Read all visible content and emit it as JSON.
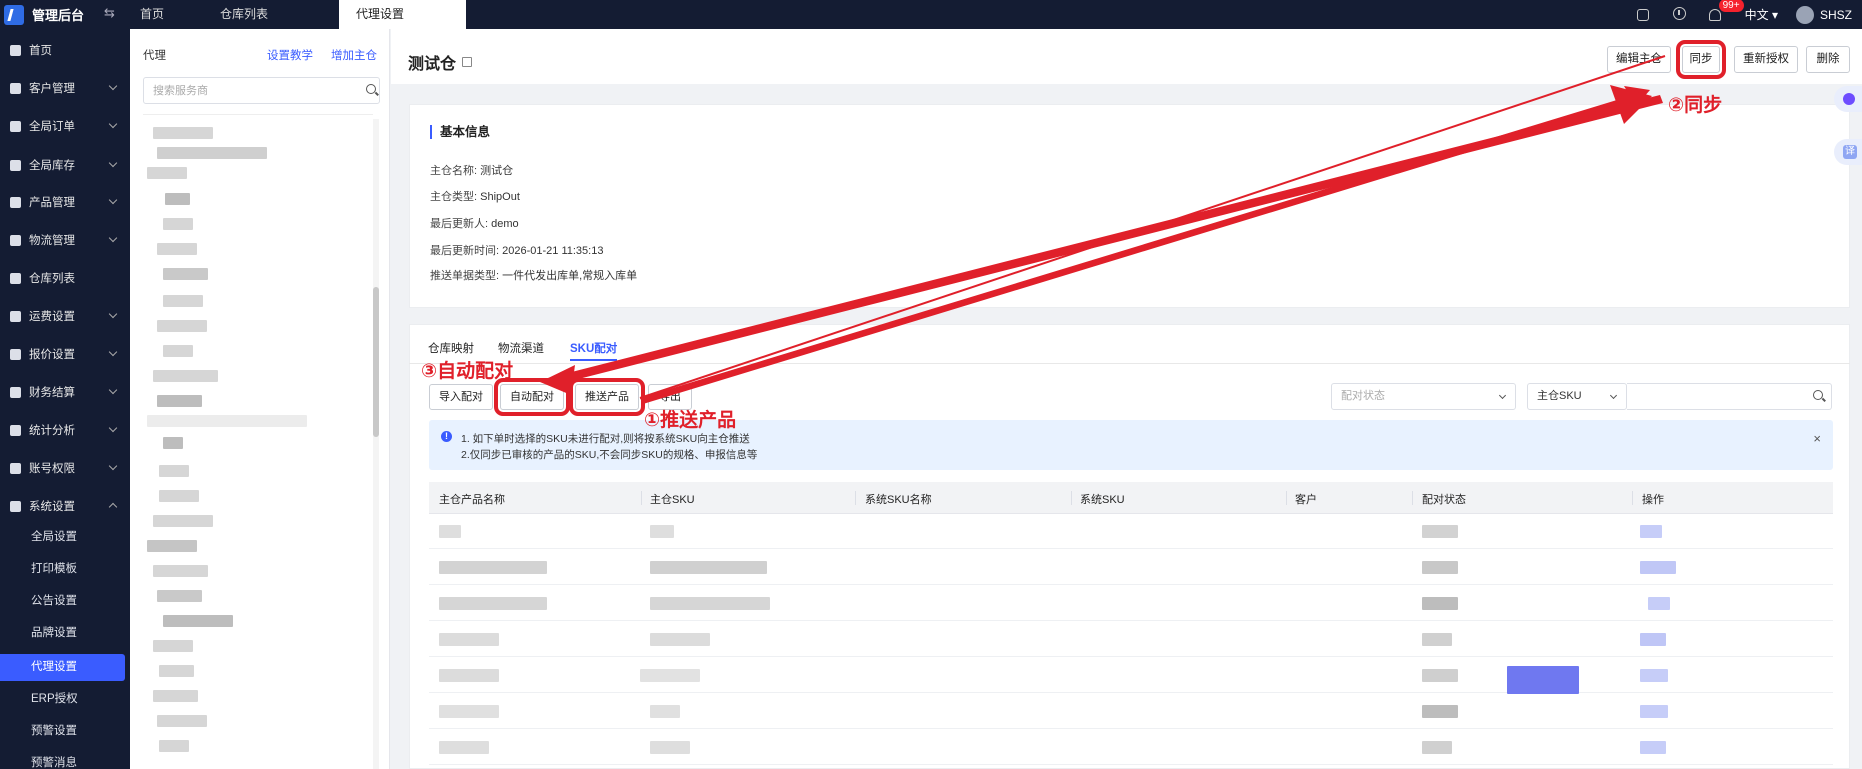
{
  "app": {
    "title": "管理后台",
    "tabs": [
      {
        "label": "首页",
        "active": false
      },
      {
        "label": "仓库列表",
        "active": false
      },
      {
        "label": "代理设置",
        "active": true
      }
    ],
    "notification_badge": "99+",
    "language": "中文",
    "user": "SHSZ"
  },
  "sidebar": {
    "items": [
      {
        "label": "首页",
        "icon": "home-icon",
        "expandable": false
      },
      {
        "label": "客户管理",
        "icon": "user-icon",
        "expandable": true
      },
      {
        "label": "全局订单",
        "icon": "order-icon",
        "expandable": true
      },
      {
        "label": "全局库存",
        "icon": "stock-icon",
        "expandable": true
      },
      {
        "label": "产品管理",
        "icon": "product-icon",
        "expandable": true
      },
      {
        "label": "物流管理",
        "icon": "truck-icon",
        "expandable": true
      },
      {
        "label": "仓库列表",
        "icon": "warehouse-icon",
        "expandable": false
      },
      {
        "label": "运费设置",
        "icon": "freight-icon",
        "expandable": true
      },
      {
        "label": "报价设置",
        "icon": "quote-icon",
        "expandable": true
      },
      {
        "label": "财务结算",
        "icon": "finance-icon",
        "expandable": true
      },
      {
        "label": "统计分析",
        "icon": "chart-icon",
        "expandable": true
      },
      {
        "label": "账号权限",
        "icon": "account-icon",
        "expandable": true
      },
      {
        "label": "系统设置",
        "icon": "settings-icon",
        "expandable": true,
        "expanded": true
      }
    ],
    "sub_items": [
      {
        "label": "全局设置",
        "active": false
      },
      {
        "label": "打印模板",
        "active": false
      },
      {
        "label": "公告设置",
        "active": false
      },
      {
        "label": "品牌设置",
        "active": false
      },
      {
        "label": "代理设置",
        "active": true
      },
      {
        "label": "ERP授权",
        "active": false
      },
      {
        "label": "预警设置",
        "active": false
      },
      {
        "label": "预警消息",
        "active": false
      }
    ]
  },
  "agent_panel": {
    "title": "代理",
    "tutorial_link": "设置教学",
    "add_link": "增加主仓",
    "search_placeholder": "搜索服务商"
  },
  "page": {
    "title": "测试仓",
    "buttons": {
      "edit": "编辑主仓",
      "sync": "同步",
      "reauth": "重新授权",
      "delete": "删除"
    }
  },
  "basic_info": {
    "title": "基本信息",
    "rows": [
      {
        "label": "主仓名称:",
        "value": "测试仓"
      },
      {
        "label": "主仓类型:",
        "value": "ShipOut"
      },
      {
        "label": "最后更新人:",
        "value": "demo"
      },
      {
        "label": "最后更新时间:",
        "value": "2026-01-21 11:35:13"
      },
      {
        "label": "推送单据类型:",
        "value": "一件代发出库单,常规入库单"
      }
    ]
  },
  "sub_tabs": [
    {
      "label": "仓库映射",
      "active": false
    },
    {
      "label": "物流渠道",
      "active": false
    },
    {
      "label": "SKU配对",
      "active": true
    }
  ],
  "actions": {
    "import": "导入配对",
    "auto_match": "自动配对",
    "push_products": "推送产品",
    "export": "导出"
  },
  "filters": {
    "status_placeholder": "配对状态",
    "field_select": "主仓SKU",
    "search_value": ""
  },
  "notice": {
    "line1": "1. 如下单时选择的SKU未进行配对,则将按系统SKU向主仓推送",
    "line2": "2.仅同步已审核的产品的SKU,不会同步SKU的规格、申报信息等"
  },
  "table": {
    "columns": [
      "主仓产品名称",
      "主仓SKU",
      "系统SKU名称",
      "系统SKU",
      "客户",
      "配对状态",
      "操作"
    ]
  },
  "annotations": {
    "step1": "①推送产品",
    "step2": "②同步",
    "step3": "③自动配对"
  },
  "colors": {
    "accent": "#3a5cff",
    "sidebar_bg": "#141c33",
    "annotation_red": "#e0202a"
  }
}
